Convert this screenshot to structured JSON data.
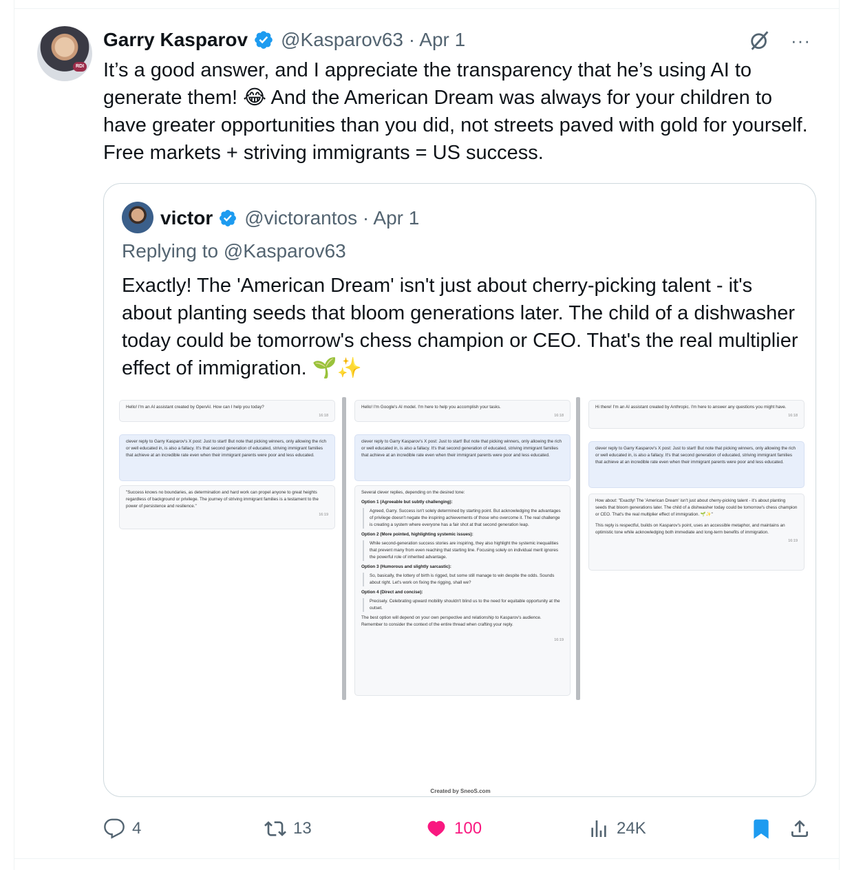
{
  "tweet": {
    "author_name": "Garry Kasparov",
    "handle_date": "@Kasparov63 · Apr 1",
    "avatar_badge": "RDI",
    "text": "It’s a good answer, and I appreciate the transparency that he’s using AI to generate them! 😂 And the American Dream was always for your children to have greater opportunities than you did, not streets paved with gold for yourself. Free markets + striving immigrants = US success.",
    "more_icon": "···"
  },
  "quote": {
    "author_name": "victor",
    "handle_date": "@victorantos · Apr 1",
    "replying_to": "Replying to @Kasparov63",
    "text": "Exactly! The 'American Dream' isn't just about cherry-picking talent - it's about planting seeds that bloom generations later. The child of a dishwasher today could be tomorrow's chess champion or CEO. That's the real multiplier effect of immigration. 🌱✨",
    "image": {
      "col1": {
        "greeting": "Hello! I'm an AI assistant created by OpenAI. How can I help you today?",
        "greeting_time": "16:18",
        "prompt": "clever reply to Garry Kasparov's X post: Just to start! But note that picking winners, only allowing the rich or well educated in, is also a fallacy. It's that second generation of educated, striving immigrant families that achieve at an incredible rate even when their immigrant parents were poor and less educated.",
        "reply": "\"Success knows no boundaries, as determination and hard work can propel anyone to great heights regardless of background or privilege. The journey of striving immigrant families is a testament to the power of persistence and resilience.\"",
        "reply_time": "16:19"
      },
      "col2": {
        "greeting": "Hello! I'm Google's AI model. I'm here to help you accomplish your tasks.",
        "greeting_time": "16:18",
        "prompt": "clever reply to Garry Kasparov's X post: Just to start! But note that picking winners, only allowing the rich or well educated in, is also a fallacy. It's that second generation of educated, striving immigrant families that achieve at an incredible rate even when their immigrant parents were poor and less educated.",
        "intro": "Several clever replies, depending on the desired tone:",
        "opt1_title": "Option 1 (Agreeable but subtly challenging):",
        "opt1_text": "Agreed, Garry. Success isn't solely determined by starting point. But acknowledging the advantages of privilege doesn't negate the inspiring achievements of those who overcome it. The real challenge is creating a system where everyone has a fair shot at that second generation leap.",
        "opt2_title": "Option 2 (More pointed, highlighting systemic issues):",
        "opt2_text": "While second-generation success stories are inspiring, they also highlight the systemic inequalities that prevent many from even reaching that starting line. Focusing solely on individual merit ignores the powerful role of inherited advantage.",
        "opt3_title": "Option 3 (Humorous and slightly sarcastic):",
        "opt3_text": "So, basically, the lottery of birth is rigged, but some still manage to win despite the odds. Sounds about right. Let's work on fixing the rigging, shall we?",
        "opt4_title": "Option 4 (Direct and concise):",
        "opt4_text": "Precisely. Celebrating upward mobility shouldn't blind us to the need for equitable opportunity at the outset.",
        "closing": "The best option will depend on your own perspective and relationship to Kasparov's audience. Remember to consider the context of the entire thread when crafting your reply.",
        "reply_time": "16:19"
      },
      "col3": {
        "greeting": "Hi there! I'm an AI assistant created by Anthropic. I'm here to answer any questions you might have.",
        "greeting_time": "16:18",
        "prompt": "clever reply to Garry Kasparov's X post: Just to start! But note that picking winners, only allowing the rich or well educated in, is also a fallacy. It's that second generation of educated, striving immigrant families that achieve at an incredible rate even when their immigrant parents were poor and less educated.",
        "reply": "How about: \"Exactly! The 'American Dream' isn't just about cherry-picking talent - it's about planting seeds that bloom generations later. The child of a dishwasher today could be tomorrow's chess champion or CEO. That's the real multiplier effect of immigration. 🌱✨\"",
        "reply2": "This reply is respectful, builds on Kasparov's point, uses an accessible metaphor, and maintains an optimistic tone while acknowledging both immediate and long-term benefits of immigration.",
        "reply_time": "16:19"
      },
      "footer": "Created by SneoS.com"
    }
  },
  "actions": {
    "replies": "4",
    "retweets": "13",
    "likes": "100",
    "views": "24K"
  },
  "colors": {
    "verified": "#1d9bf0",
    "like": "#f91880",
    "secondary_text": "#536471",
    "bookmark": "#1d9bf0"
  },
  "icons": [
    "grok-icon",
    "more-icon",
    "reply-icon",
    "retweet-icon",
    "like-icon",
    "views-icon",
    "bookmark-icon",
    "share-icon",
    "verified-icon"
  ]
}
